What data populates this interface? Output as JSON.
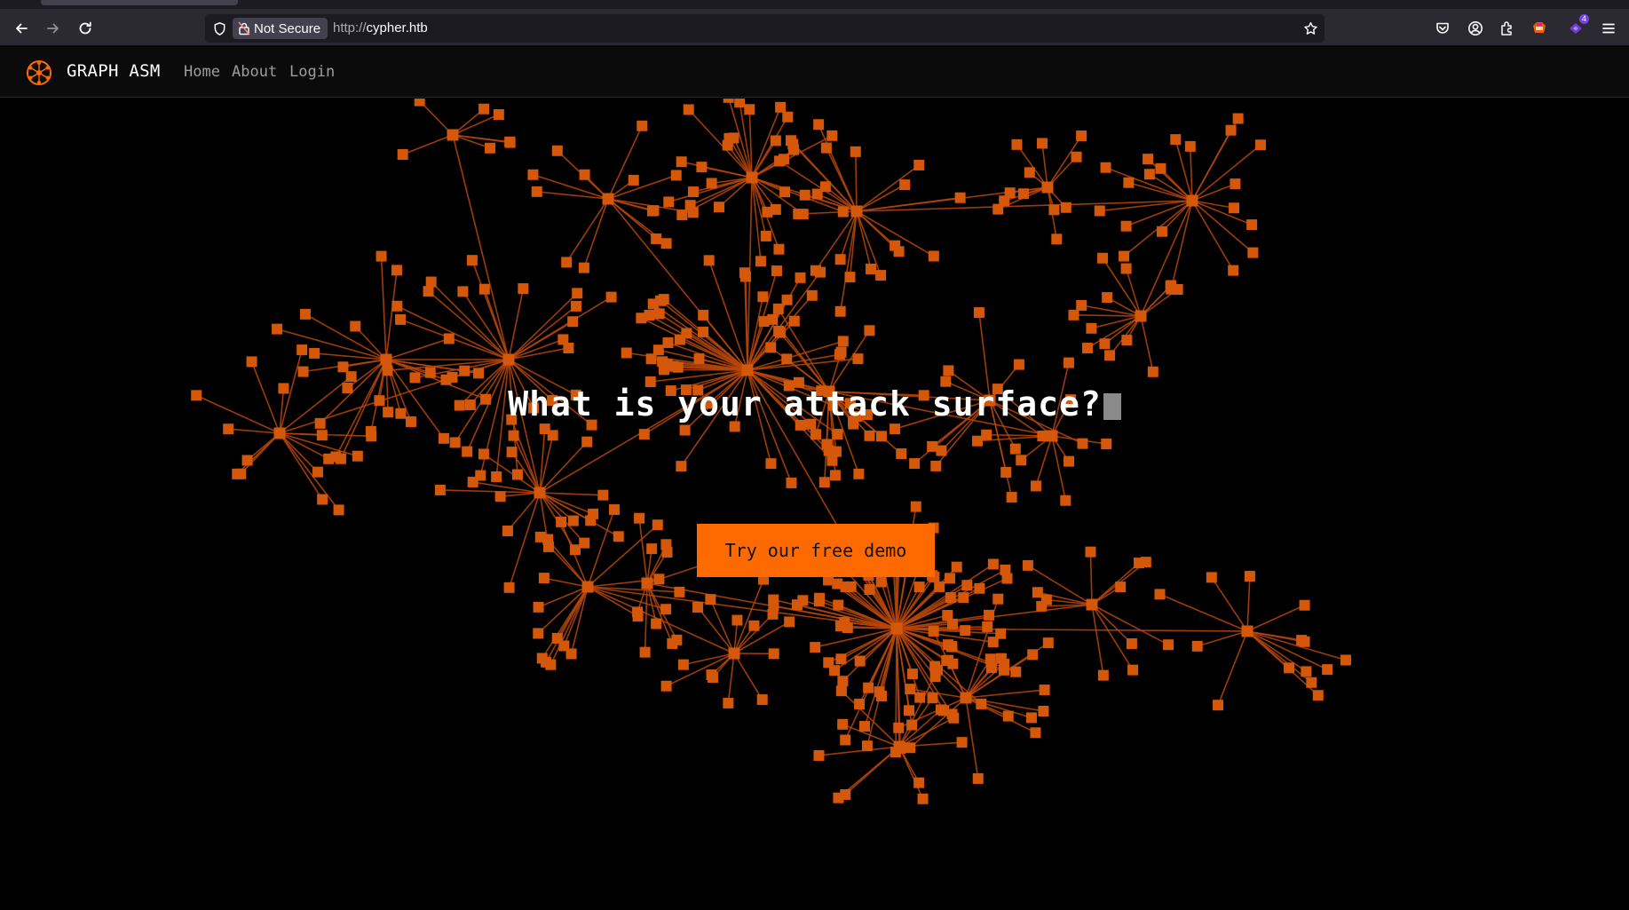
{
  "browser": {
    "security_label": "Not Secure",
    "url_scheme": "http://",
    "url_host": "cypher.htb",
    "extension_badge": "4",
    "icons": [
      "back-arrow-icon",
      "forward-arrow-icon",
      "reload-icon",
      "shield-icon",
      "lock-warning-icon",
      "bookmark-star-icon",
      "pocket-icon",
      "account-icon",
      "extensions-icon",
      "extension-icon",
      "menu-icon"
    ]
  },
  "site": {
    "brand": "GRAPH ASM",
    "nav": [
      "Home",
      "About",
      "Login"
    ],
    "headline": "What is your attack surface?",
    "cta": "Try our free demo"
  },
  "colors": {
    "accent": "#ff6a00",
    "graph_node": "#d4570a",
    "graph_edge": "#b8470a",
    "background": "#000000"
  }
}
